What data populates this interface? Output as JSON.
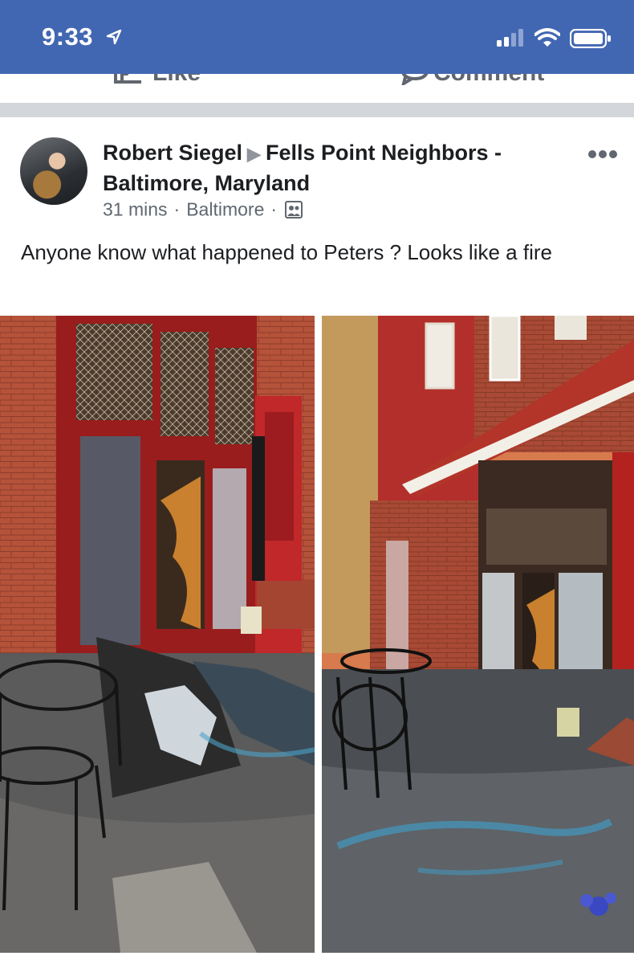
{
  "status_bar": {
    "time": "9:33",
    "icons": [
      "location-arrow-icon",
      "signal-icon",
      "wifi-icon",
      "battery-icon"
    ]
  },
  "actions": {
    "like_label": "Like",
    "comment_label": "Comment"
  },
  "post": {
    "author": "Robert Siegel",
    "group": "Fells Point Neighbors - Baltimore, Maryland",
    "time": "31 mins",
    "location": "Baltimore",
    "text": "Anyone know what happened to Peters ? Looks like a fire",
    "photos": [
      "burned storefront close-up",
      "burned storefront alley view"
    ]
  },
  "colors": {
    "brand": "#4267b2",
    "separator": "#d3d6db",
    "meta_text": "#606770"
  }
}
